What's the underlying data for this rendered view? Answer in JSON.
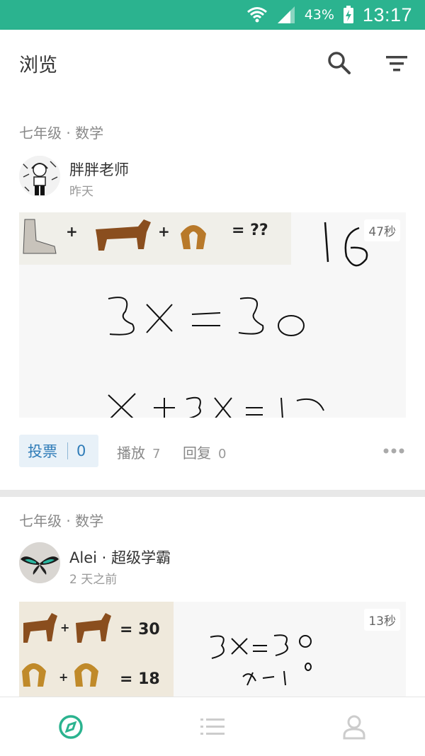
{
  "status_bar": {
    "battery_percent": "43%",
    "time": "13:17"
  },
  "app_bar": {
    "title": "浏览",
    "search_icon": "search-icon",
    "filter_icon": "filter-icon"
  },
  "colors": {
    "accent": "#2bb38f",
    "vote_text": "#2f7cb8",
    "vote_bg": "#e8f1f8"
  },
  "posts": [
    {
      "category": "七年级 · 数学",
      "author": "胖胖老师",
      "time": "昨天",
      "duration": "47秒",
      "vote_label": "投票",
      "vote_count": "0",
      "play_label": "播放",
      "play_count": "7",
      "reply_label": "回复",
      "reply_count": "0"
    },
    {
      "category": "七年级 · 数学",
      "author": "Alei · 超级学霸",
      "time": "2 天之前",
      "duration": "13秒"
    }
  ],
  "tab_bar": {
    "items": [
      "compass-icon",
      "list-icon",
      "profile-icon"
    ],
    "active_index": 0
  }
}
